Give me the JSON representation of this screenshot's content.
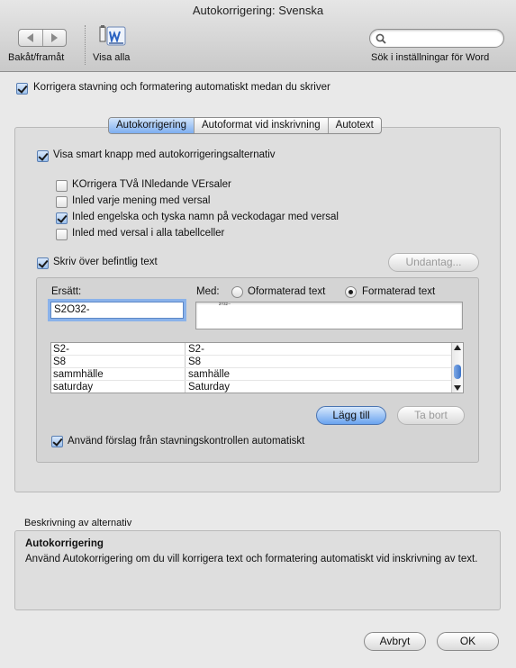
{
  "window": {
    "title": "Autokorrigering: Svenska"
  },
  "toolbar": {
    "back_forward_label": "Bakåt/framåt",
    "show_all_label": "Visa alla",
    "search_label": "Sök i inställningar för Word",
    "search_placeholder": ""
  },
  "main_option": {
    "label": "Korrigera stavning och formatering automatiskt medan du skriver",
    "checked": true
  },
  "tabs": [
    {
      "label": "Autokorrigering",
      "active": true
    },
    {
      "label": "Autoformat vid inskrivning",
      "active": false
    },
    {
      "label": "Autotext",
      "active": false
    }
  ],
  "smart_button": {
    "label": "Visa smart knapp med autokorrigeringsalternativ",
    "checked": true
  },
  "options": [
    {
      "label": "KOrrigera TVå INledande VErsaler",
      "checked": false
    },
    {
      "label": "Inled varje mening med versal",
      "checked": false
    },
    {
      "label": "Inled engelska och tyska namn på veckodagar med versal",
      "checked": true
    },
    {
      "label": "Inled med versal i alla tabellceller",
      "checked": false
    }
  ],
  "replace_text": {
    "label": "Skriv över befintlig text",
    "checked": true,
    "exceptions_button": "Undantag..."
  },
  "replace": {
    "label": "Ersätt:",
    "value": "S2O32-"
  },
  "with": {
    "label": "Med:",
    "option_plain": "Oformaterad text",
    "option_formatted": "Formaterad text",
    "selected": "formatted",
    "preview": "²⁰³²⁻"
  },
  "table_rows": [
    {
      "replace": "S2-",
      "with": "S2-"
    },
    {
      "replace": "S8",
      "with": "S8"
    },
    {
      "replace": "sammhälle",
      "with": "samhälle"
    },
    {
      "replace": "saturday",
      "with": "Saturday"
    }
  ],
  "buttons": {
    "add": "Lägg till",
    "remove": "Ta bort",
    "cancel": "Avbryt",
    "ok": "OK"
  },
  "spellcheck": {
    "label": "Använd förslag från stavningskontrollen automatiskt",
    "checked": true
  },
  "description": {
    "section_label": "Beskrivning av alternativ",
    "title": "Autokorrigering",
    "text": "Använd Autokorrigering om du vill korrigera text och formatering automatiskt vid inskrivning av text."
  }
}
